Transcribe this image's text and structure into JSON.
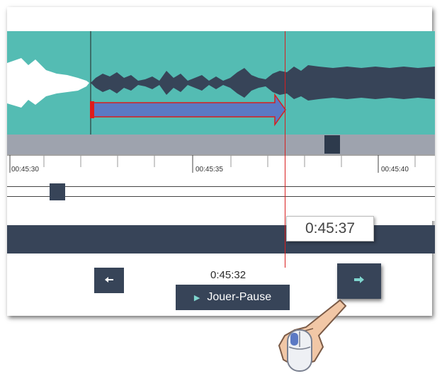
{
  "ruler": {
    "ticks": [
      "00:45:30",
      "00:45:35",
      "00:45:40"
    ]
  },
  "tooltip": {
    "time": "0:45:37"
  },
  "controls": {
    "current_time": "0:45:32",
    "play_pause_label": "Jouer-Pause",
    "prev_icon": "left-arrow-icon",
    "next_icon": "right-arrow-icon"
  },
  "colors": {
    "waveform_bg": "#54bcb3",
    "waveform_played": "#ffffff",
    "waveform": "#374458",
    "cursor": "#d81e1e",
    "arrow": "#5b79c4"
  }
}
